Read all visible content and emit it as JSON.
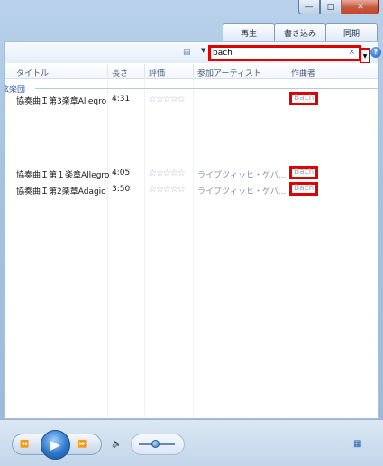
{
  "tabs": [
    "再生",
    "書き込み",
    "同期"
  ],
  "search": {
    "value": "bach",
    "clear_icon": "×"
  },
  "columns": {
    "title": "タイトル",
    "length": "長さ",
    "rating": "評価",
    "artist": "参加アーティスト",
    "composer": "作曲者"
  },
  "group_label": "弦楽団",
  "rows": [
    {
      "title": "協奏曲Ｉ第3楽章Allegro",
      "length": "4:31",
      "artist": "",
      "composer": "Bach"
    },
    {
      "title": "協奏曲Ｉ第１楽章Allegro",
      "length": "4:05",
      "artist": "ライプツィッヒ・ゲバ...",
      "composer": "Bach"
    },
    {
      "title": "協奏曲Ｉ第2楽章Adagio",
      "length": "3:50",
      "artist": "ライプツィッヒ・ゲバ...",
      "composer": "Bach"
    }
  ],
  "highlight_color": "#e00000"
}
